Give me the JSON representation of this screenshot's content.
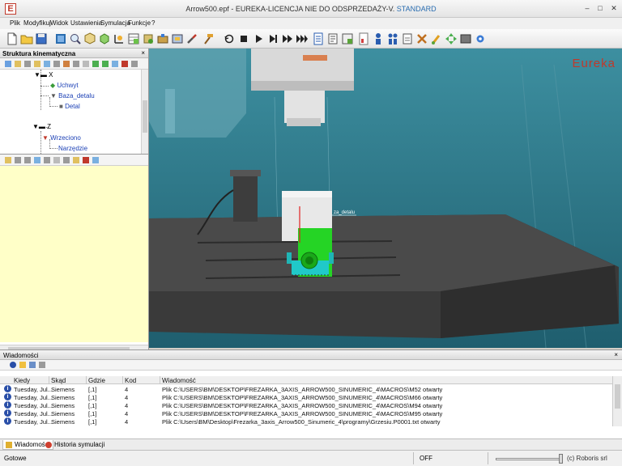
{
  "window": {
    "title_prefix": "Arrow500.epf - EUREKA-LICENCJA NIE DO ODSPRZEDAŻY-V.",
    "title_edition": "STANDARD",
    "app_icon_letter": "E"
  },
  "menu": [
    "Plik",
    "Modyfikuj",
    "Widok",
    "Ustawienia",
    "Symulacja",
    "Funkcje",
    "?"
  ],
  "kinematic_panel": {
    "title": "Struktura kinematyczna",
    "tree": [
      {
        "label": "X",
        "level": 0
      },
      {
        "label": "Uchwyt",
        "level": 1
      },
      {
        "label": "Baza_detalu",
        "level": 1
      },
      {
        "label": "Detal",
        "level": 2
      },
      {
        "label": "Z",
        "level": 0
      },
      {
        "label": "Wrzeciono",
        "level": 1
      },
      {
        "label": "Narzędzie",
        "level": 2
      }
    ]
  },
  "viewport": {
    "logo": "Eureka",
    "frame_label": "za_detalu"
  },
  "messages": {
    "title": "Wiadomości",
    "columns": [
      "Kiedy",
      "Skąd",
      "Gdzie",
      "Kod",
      "Wiadomość"
    ],
    "rows": [
      {
        "when": "Tuesday, Jul...",
        "from": "Siemens",
        "where": "[,1]",
        "code": "4",
        "message": "Plik C:\\USERS\\BM\\DESKTOP\\FREZARKA_3AXIS_ARROW500_SINUMERIC_4\\MACROS\\M52 otwarty"
      },
      {
        "when": "Tuesday, Jul...",
        "from": "Siemens",
        "where": "[,1]",
        "code": "4",
        "message": "Plik C:\\USERS\\BM\\DESKTOP\\FREZARKA_3AXIS_ARROW500_SINUMERIC_4\\MACROS\\M66 otwarty"
      },
      {
        "when": "Tuesday, Jul...",
        "from": "Siemens",
        "where": "[,1]",
        "code": "4",
        "message": "Plik C:\\USERS\\BM\\DESKTOP\\FREZARKA_3AXIS_ARROW500_SINUMERIC_4\\MACROS\\M94 otwarty"
      },
      {
        "when": "Tuesday, Jul...",
        "from": "Siemens",
        "where": "[,1]",
        "code": "4",
        "message": "Plik C:\\USERS\\BM\\DESKTOP\\FREZARKA_3AXIS_ARROW500_SINUMERIC_4\\MACROS\\M95 otwarty"
      },
      {
        "when": "Tuesday, Jul...",
        "from": "Siemens",
        "where": "[,1]",
        "code": "4",
        "message": "Plik C:\\Users\\BM\\Desktop\\Frezarka_3axis_Arrow500_Sinumeric_4\\programy\\Grzesiu.P0001.txt otwarty"
      }
    ]
  },
  "tabs": [
    "Wiadomości",
    "Historia symulacji"
  ],
  "status": {
    "left": "Gotowe",
    "mode": "OFF",
    "copyright": "(c) Roboris srl"
  },
  "colors": {
    "viewport_bg": "#2c6e7e",
    "part_green": "#22dd22",
    "link_blue": "#1a3fb5",
    "message_bg_yellow": "#ffffc8"
  }
}
